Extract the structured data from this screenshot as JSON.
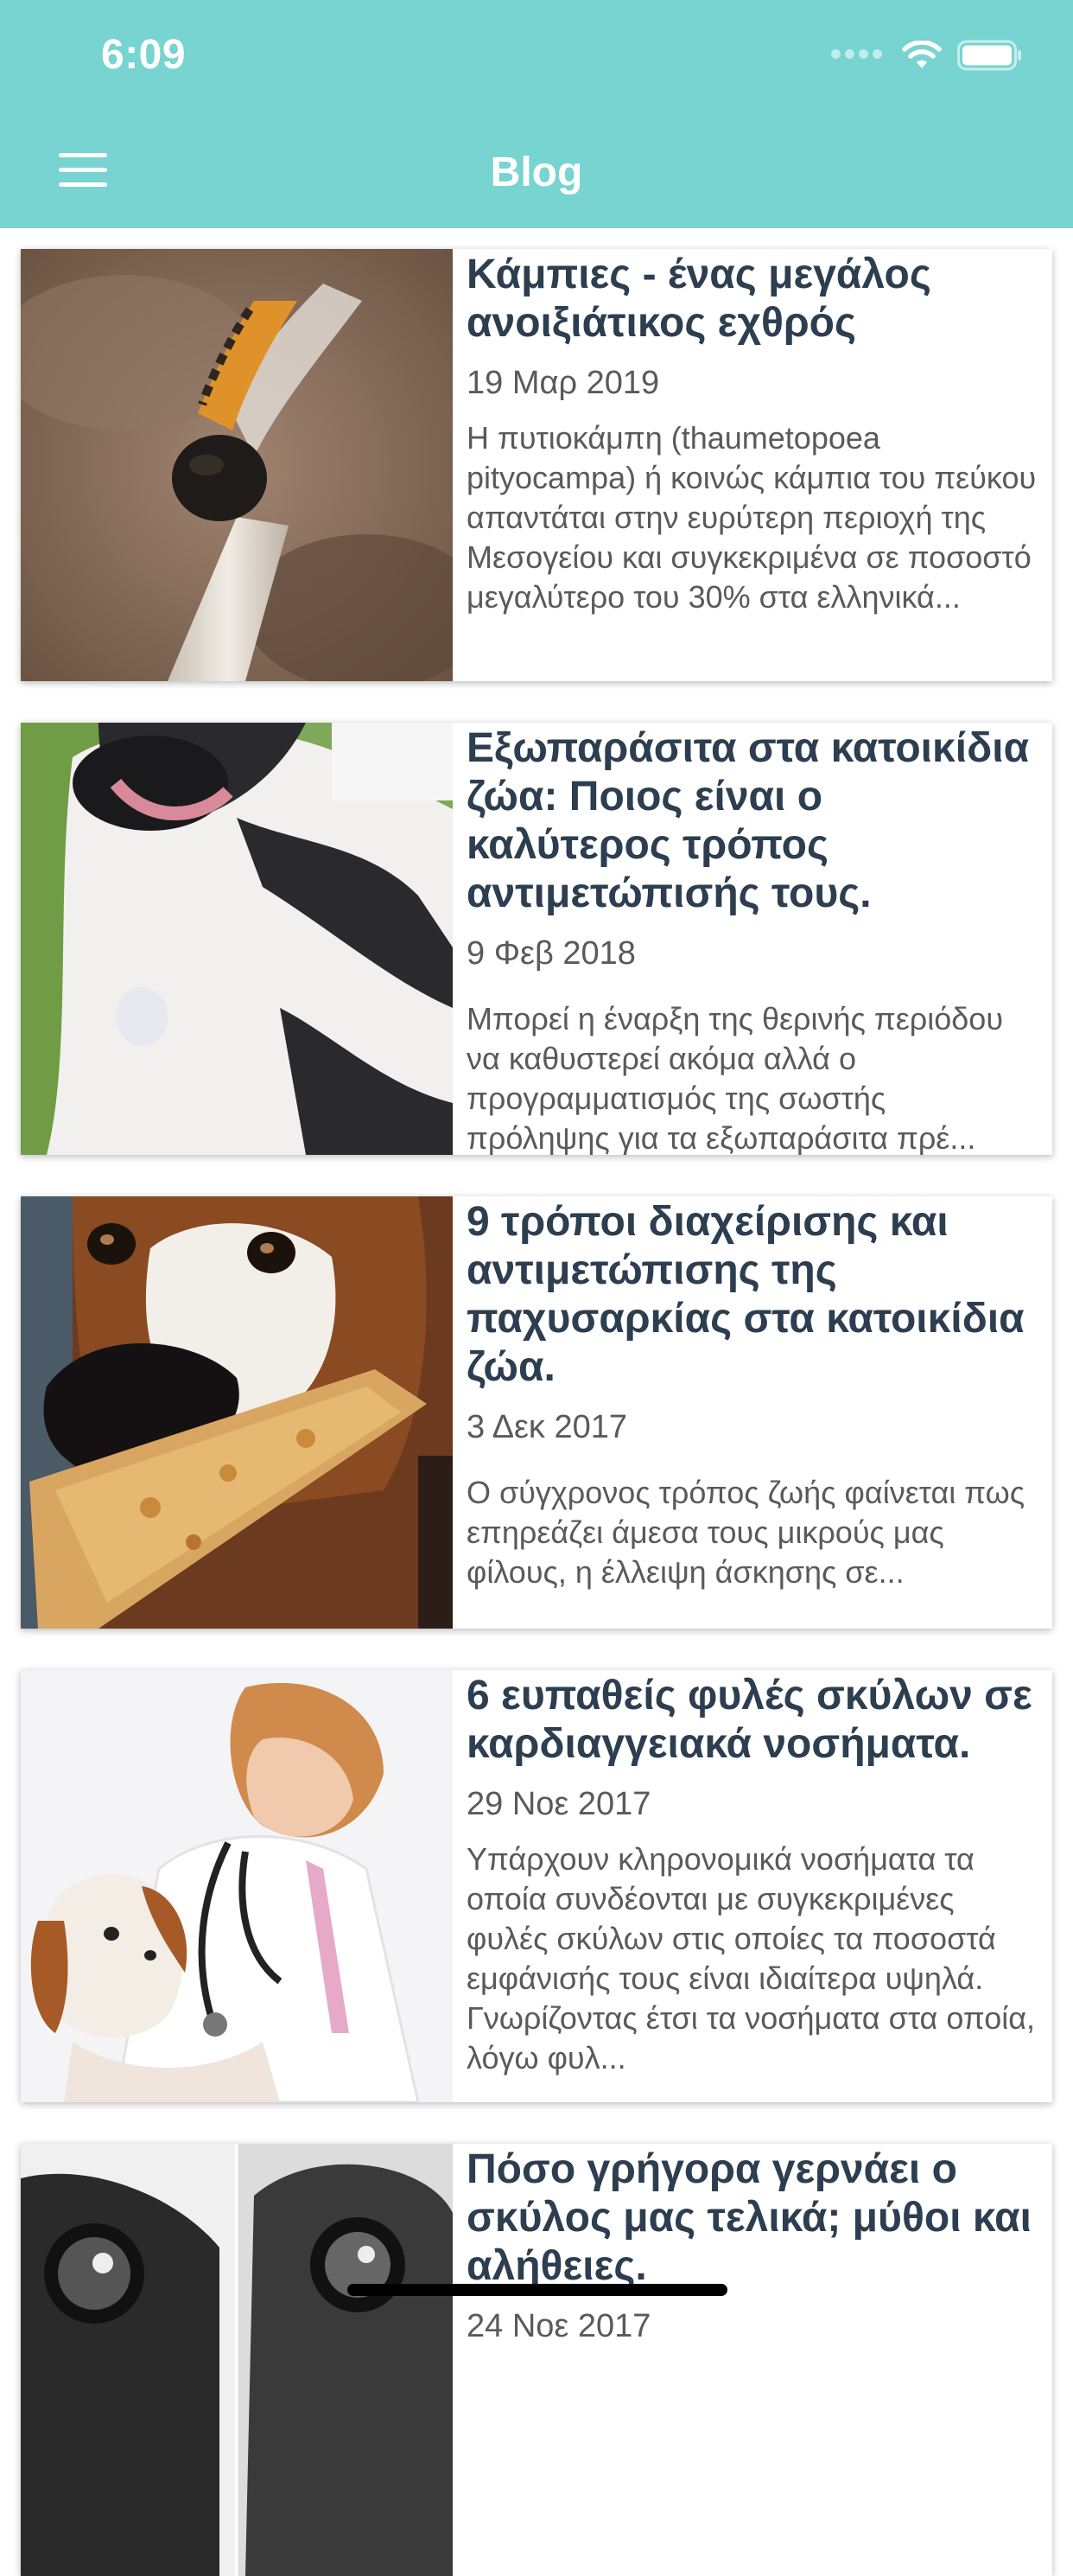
{
  "status_bar": {
    "time": "6:09"
  },
  "nav": {
    "title": "Blog"
  },
  "colors": {
    "header": "#77d4d0",
    "title_text": "#2c3e50",
    "body_text": "#5a5a5a"
  },
  "posts": [
    {
      "title": "Κάμπιες - ένας μεγάλος ανοιξιάτικος εχθρός",
      "date": "19 Μαρ 2019",
      "excerpt": "Η πυτιοκάμπη (thaumetopoea pityocampa) ή κοινώς κάμπια του πεύκου απαντάται στην ευρύτερη περιοχή της Μεσογείου και συγκεκριμένα σε ποσοστό μεγαλύτερο του 30% στα ελληνικά...",
      "image": "caterpillar-photo"
    },
    {
      "title": "Εξωπαράσιτα στα κατοικίδια ζώα: Ποιος είναι ο καλύτερος τρόπος αντιμετώπισής τους.",
      "date": "9 Φεβ 2018",
      "excerpt": "Μπορεί η έναρξη της θερινής περιόδου να καθυστερεί ακόμα αλλά ο προγραμματισμός της σωστής πρόληψης για τα εξωπαράσιτα πρέ...",
      "image": "husky-scratching-photo"
    },
    {
      "title": "9 τρόποι διαχείρισης και αντιμετώπισης της παχυσαρκίας στα κατοικίδια ζώα.",
      "date": "3 Δεκ 2017",
      "excerpt": "Ο σύγχρονος τρόπος ζωής  φαίνεται πως επηρεάζει άμεσα τους μικρούς μας φίλους, η έλλειψη άσκησης σε...",
      "image": "dog-pizza-photo"
    },
    {
      "title": "6 ευπαθείς φυλές σκύλων σε καρδιαγγειακά νοσήματα.",
      "date": "29 Νοε 2017",
      "excerpt": "Υπάρχουν κληρονομικά νοσήματα τα οποία συνδέονται με συγκεκριμένες φυλές σκύλων στις οποίες τα ποσοστά εμφάνισής τους είναι ιδιαίτερα υψηλά. Γνωρίζοντας έτσι τα νοσήματα στα οποία, λόγω φυλ...",
      "image": "vet-puppy-photo"
    },
    {
      "title": "Πόσο γρήγορα γερνάει ο σκύλος μας τελικά; μύθοι και αλήθειες.",
      "date": "24 Νοε 2017",
      "excerpt": "",
      "image": "pug-aging-photo"
    }
  ]
}
